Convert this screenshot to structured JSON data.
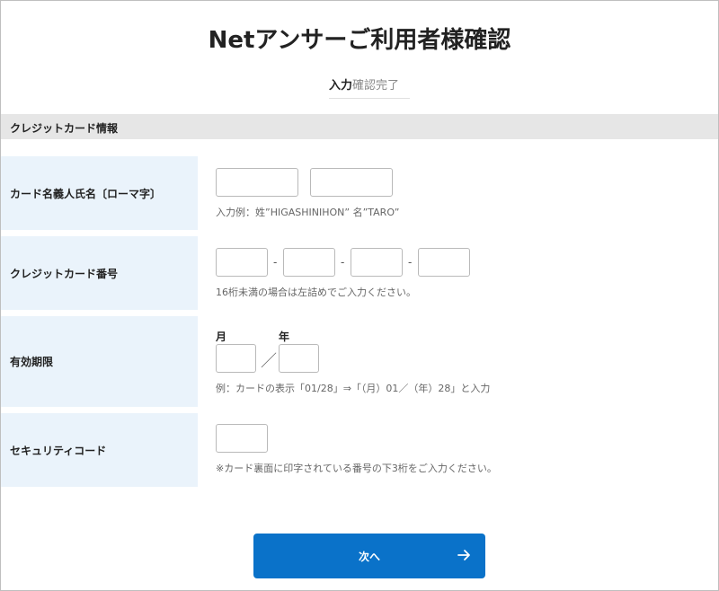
{
  "page": {
    "title": "Netアンサーご利用者様確認",
    "steps": {
      "step1": "入力",
      "step2": "確認",
      "step3": "完了"
    }
  },
  "section": {
    "title": "クレジットカード情報"
  },
  "form": {
    "name": {
      "label": "カード名義人氏名〔ローマ字〕",
      "note": "入力例：姓”HIGASHINIHON” 名”TARO”"
    },
    "card_number": {
      "label": "クレジットカード番号",
      "separator": "-",
      "note": "16桁未満の場合は左詰めでご入力ください。"
    },
    "expiry": {
      "label": "有効期限",
      "month_label": "月",
      "year_label": "年",
      "divider": "／",
      "note": "例：カードの表示「01/28」⇒「（月）01／（年）28」と入力"
    },
    "security_code": {
      "label": "セキュリティコード",
      "note": "※カード裏面に印字されている番号の下3桁をご入力ください。"
    }
  },
  "actions": {
    "next_label": "次へ",
    "next_icon": "arrow-right-icon"
  }
}
